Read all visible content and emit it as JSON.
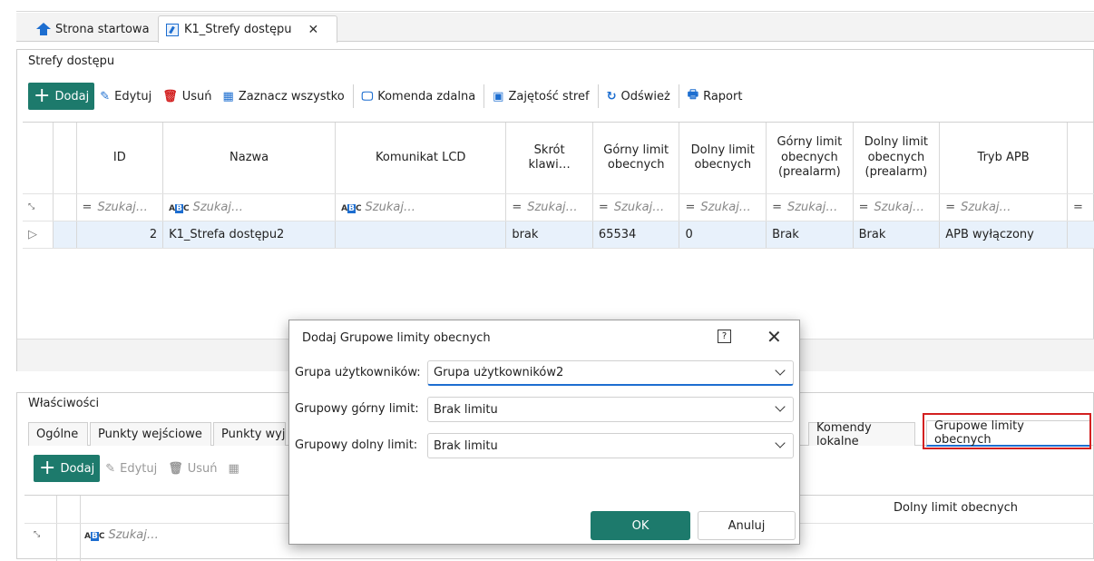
{
  "tabs": [
    {
      "label": "Strona startowa",
      "icon": "home-icon"
    },
    {
      "label": "K1_Strefy dostępu",
      "icon": "doc-icon",
      "active": true
    }
  ],
  "panel": {
    "title": "Strefy dostępu"
  },
  "toolbar": {
    "add": "Dodaj",
    "edit": "Edytuj",
    "delete": "Usuń",
    "select_all": "Zaznacz wszystko",
    "remote": "Komenda zdalna",
    "occupancy": "Zajętość stref",
    "refresh": "Odśwież",
    "report": "Raport"
  },
  "grid": {
    "columns": [
      "ID",
      "Nazwa",
      "Komunikat LCD",
      "Skrót klawi…",
      "Górny limit obecnych",
      "Dolny limit obecnych",
      "Górny limit obecnych (prealarm)",
      "Dolny limit obecnych (prealarm)",
      "Tryb APB"
    ],
    "filter_placeholder": "Szukaj…",
    "rows": [
      {
        "id": "2",
        "name": "K1_Strefa dostępu2",
        "lcd": "",
        "shortcut": "brak",
        "upper": "65534",
        "lower": "0",
        "upper_pre": "Brak",
        "lower_pre": "Brak",
        "apb": "APB wyłączony"
      }
    ]
  },
  "props": {
    "title": "Właściwości",
    "tabs": [
      "Ogólne",
      "Punkty wejściowe",
      "Punkty wyjś",
      "Komendy lokalne",
      "Grupowe limity obecnych"
    ],
    "active_tab": "Grupowe limity obecnych",
    "toolbar": {
      "add": "Dodaj",
      "edit": "Edytuj",
      "delete": "Usuń"
    },
    "col_header": "Dolny limit obecnych",
    "filter_placeholder": "Szukaj…"
  },
  "dialog": {
    "title": "Dodaj Grupowe limity obecnych",
    "fields": [
      {
        "label": "Grupa użytkowników:",
        "value": "Grupa użytkowników2"
      },
      {
        "label": "Grupowy górny limit:",
        "value": "Brak limitu"
      },
      {
        "label": "Grupowy dolny limit:",
        "value": "Brak limitu"
      }
    ],
    "ok": "OK",
    "cancel": "Anuluj"
  },
  "colors": {
    "accent": "#1d7a6c",
    "blue": "#1d6ed0",
    "highlight": "#d32020"
  }
}
